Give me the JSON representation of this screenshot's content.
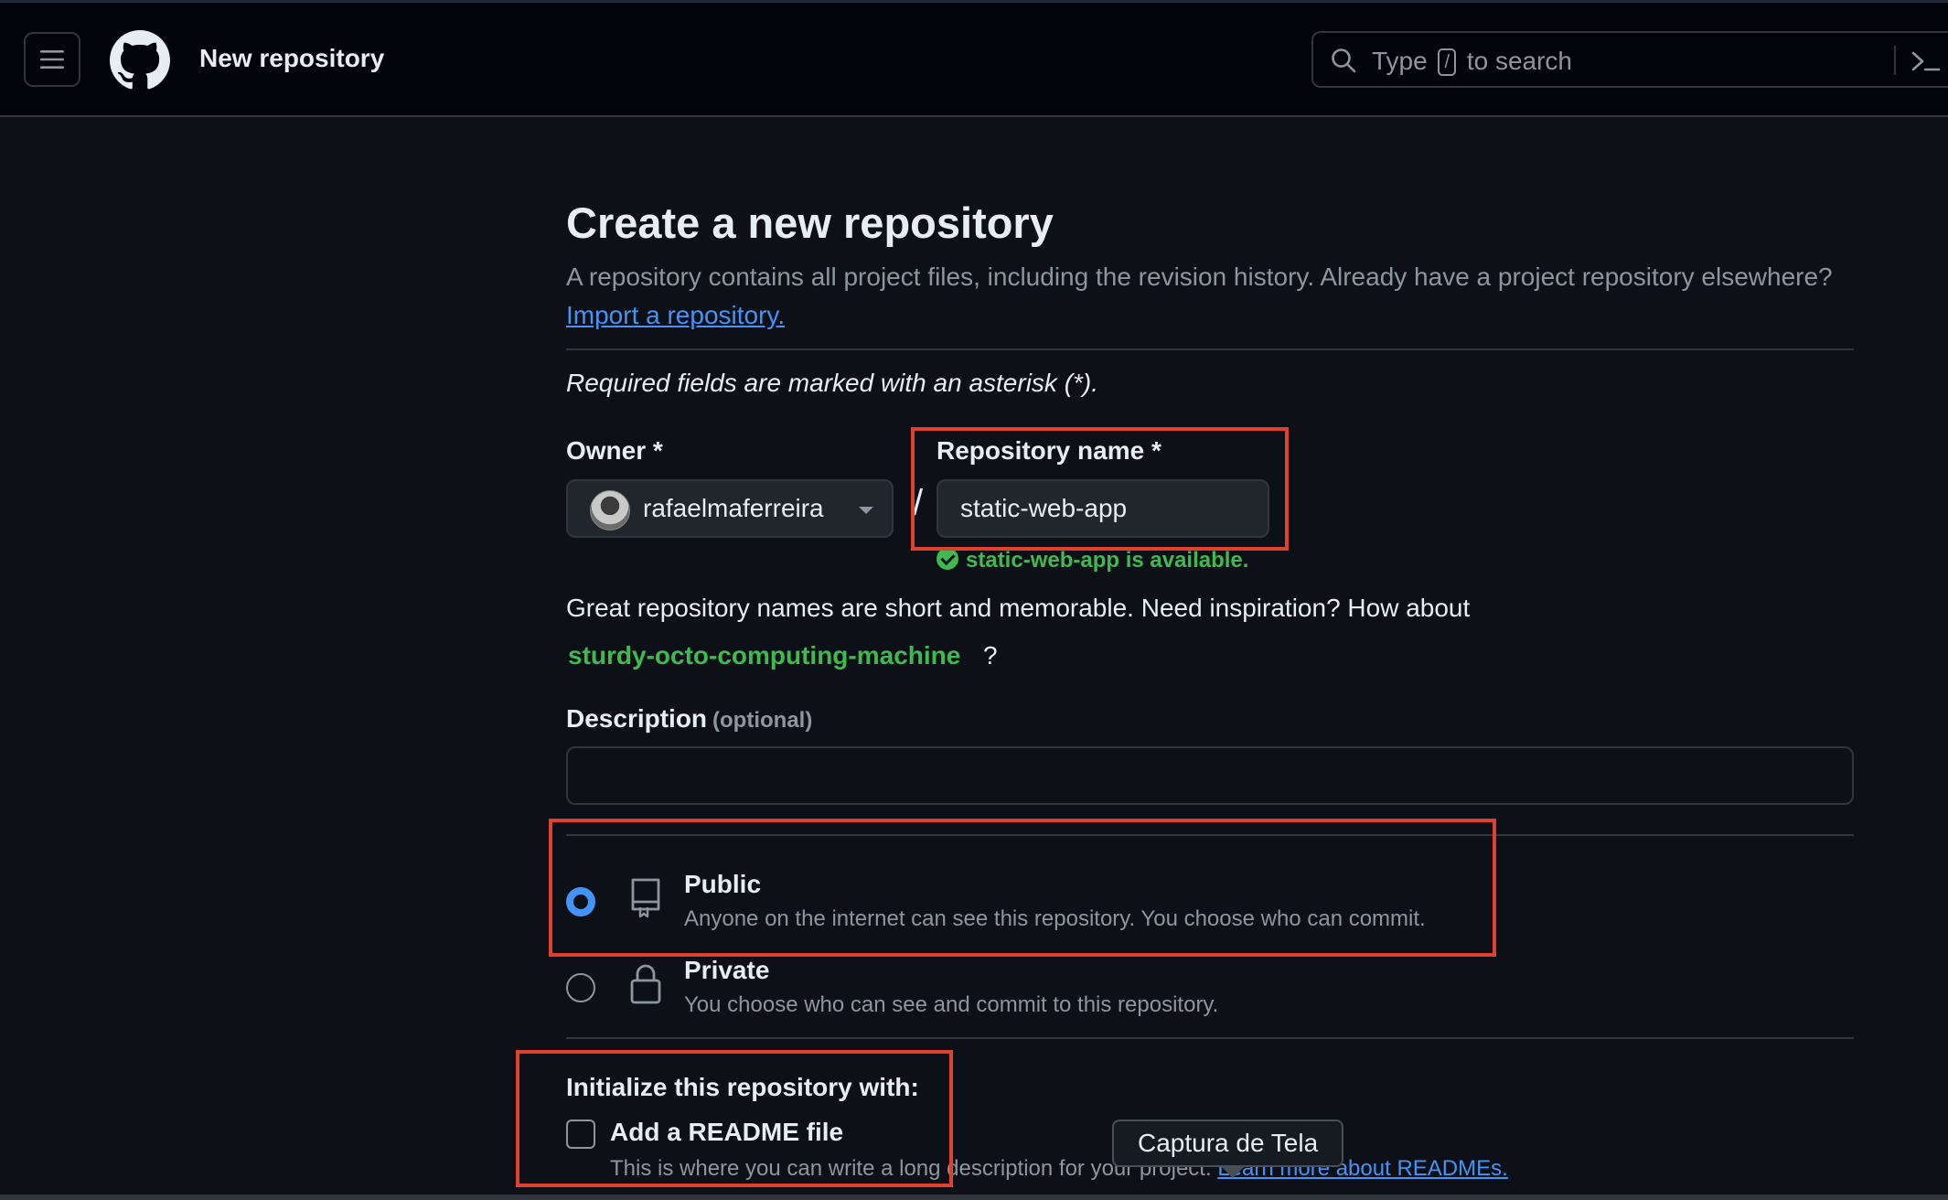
{
  "header": {
    "title": "New repository",
    "search_prefix": "Type",
    "search_key": "/",
    "search_suffix": "to search"
  },
  "page": {
    "heading": "Create a new repository",
    "subtitle": "A repository contains all project files, including the revision history. Already have a project repository elsewhere?",
    "import_link": "Import a repository.",
    "required_note": "Required fields are marked with an asterisk (*)."
  },
  "form": {
    "owner_label": "Owner *",
    "owner_value": "rafaelmaferreira",
    "slash": "/",
    "repo_label": "Repository name *",
    "repo_value": "static-web-app",
    "availability": "static-web-app is available.",
    "inspiration": "Great repository names are short and memorable. Need inspiration? How about",
    "suggestion": "sturdy-octo-computing-machine",
    "suggestion_suffix": "?",
    "description_label": "Description",
    "description_optional": "(optional)",
    "description_value": ""
  },
  "visibility": {
    "selected": "Public",
    "public_title": "Public",
    "public_desc": "Anyone on the internet can see this repository. You choose who can commit.",
    "private_title": "Private",
    "private_desc": "You choose who can see and commit to this repository."
  },
  "initialize": {
    "heading": "Initialize this repository with:",
    "readme_label": "Add a README file",
    "readme_checked": false,
    "readme_desc": "This is where you can write a long description for your project.",
    "readme_link": "Learn more about READMEs."
  },
  "tooltip": {
    "text": "Captura de Tela"
  },
  "colors": {
    "background": "#0d1117",
    "header": "#010409",
    "accent_blue": "#4493f8",
    "success_green": "#3fb950",
    "highlight_red": "#e0412f"
  }
}
